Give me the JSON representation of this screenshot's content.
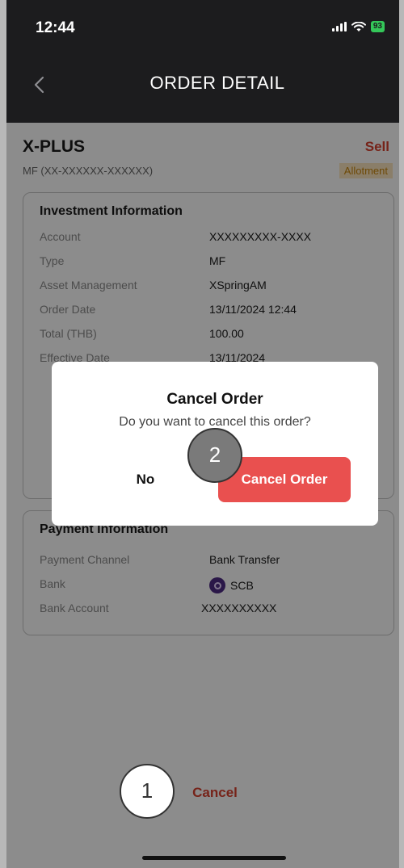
{
  "status_bar": {
    "time": "12:44",
    "battery": "93"
  },
  "header": {
    "title": "ORDER DETAIL"
  },
  "fund": {
    "name": "X-PLUS",
    "code": "MF (XX-XXXXXX-XXXXXX)",
    "side": "Sell",
    "status": "Allotment"
  },
  "investment": {
    "title": "Investment Information",
    "rows": [
      {
        "label": "Account",
        "value": "XXXXXXXXX-XXXX"
      },
      {
        "label": "Type",
        "value": "MF"
      },
      {
        "label": "Asset Management",
        "value": "XSpringAM"
      },
      {
        "label": "Order Date",
        "value": "13/11/2024 12:44"
      },
      {
        "label": "Total (THB)",
        "value": "100.00"
      },
      {
        "label": "Effective Date",
        "value": "13/11/2024"
      }
    ]
  },
  "payment": {
    "title": "Payment Information",
    "rows": [
      {
        "label": "Payment Channel",
        "value": "Bank Transfer"
      },
      {
        "label": "Bank",
        "value": "SCB"
      },
      {
        "label": "Bank Account",
        "value": "XXXXXXXXXX"
      }
    ]
  },
  "footer": {
    "cancel_label": "Cancel"
  },
  "dialog": {
    "title": "Cancel Order",
    "message": "Do you want to cancel this order?",
    "no_label": "No",
    "confirm_label": "Cancel Order"
  },
  "markers": {
    "one": "1",
    "two": "2"
  },
  "colors": {
    "accent_red": "#e9504f",
    "sell_red": "#d8412f",
    "badge_bg": "#fce5c0",
    "badge_text": "#c8860c",
    "header_bg": "#1c1c1e"
  }
}
